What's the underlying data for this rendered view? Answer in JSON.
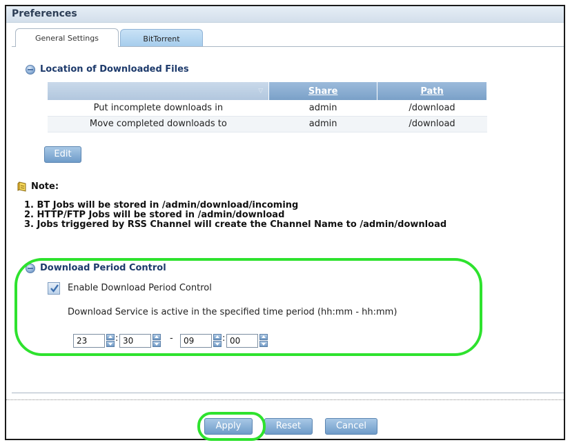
{
  "window": {
    "title": "Preferences"
  },
  "tabs": [
    {
      "label": "General Settings",
      "active": true
    },
    {
      "label": "BitTorrent",
      "active": false
    }
  ],
  "location_section": {
    "title": "Location of Downloaded Files",
    "columns": [
      "",
      "Share",
      "Path"
    ],
    "rows": [
      {
        "label": "Put incomplete downloads in",
        "share": "admin",
        "path": "/download"
      },
      {
        "label": "Move completed downloads to",
        "share": "admin",
        "path": "/download"
      }
    ],
    "edit_label": "Edit"
  },
  "note": {
    "title": "Note:",
    "lines": [
      "1. BT Jobs will be stored in /admin/download/incoming",
      "2. HTTP/FTP Jobs will be stored in /admin/download",
      "3. Jobs triggered by RSS Channel will create the Channel Name to /admin/download"
    ]
  },
  "period_section": {
    "title": "Download Period Control",
    "enable_label": "Enable Download Period Control",
    "enabled": true,
    "description": "Download Service is active in the specified time period (hh:mm - hh:mm)",
    "start_hour": "23",
    "start_minute": "30",
    "end_hour": "09",
    "end_minute": "00",
    "colon": ":",
    "dash": "-"
  },
  "buttons": {
    "apply": "Apply",
    "reset": "Reset",
    "cancel": "Cancel"
  },
  "colors": {
    "highlight": "#2ee22e",
    "header_blue": "#7aa0c8",
    "title_text": "#2d3e56"
  }
}
